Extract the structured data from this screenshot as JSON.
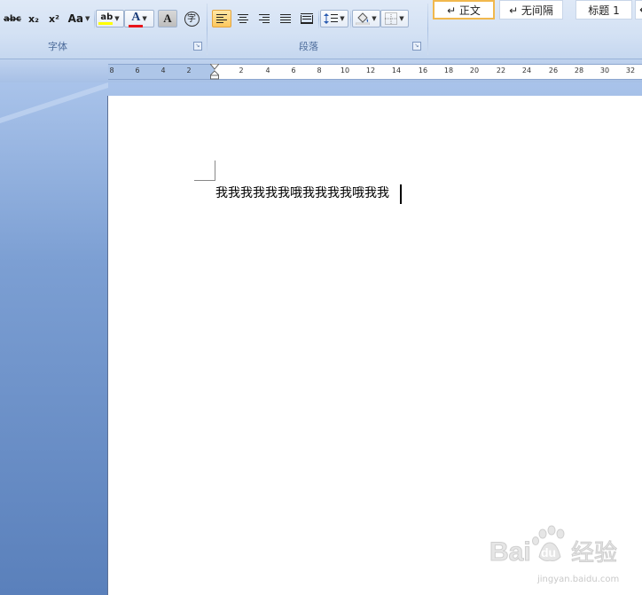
{
  "ribbon": {
    "font_group": {
      "label": "字体",
      "buttons": [
        {
          "name": "strikethrough-button",
          "label": "abc"
        },
        {
          "name": "subscript-button",
          "label": "x₂"
        },
        {
          "name": "superscript-button",
          "label": "x²"
        },
        {
          "name": "change-case-button",
          "label": "Aa"
        },
        {
          "name": "text-highlight-button",
          "label": "ab"
        },
        {
          "name": "font-color-button",
          "label": "A"
        },
        {
          "name": "character-shading-button",
          "label": "A"
        },
        {
          "name": "enclose-characters-button",
          "label": "字"
        }
      ]
    },
    "paragraph_group": {
      "label": "段落"
    },
    "styles": [
      {
        "label": "↵ 正文",
        "selected": true
      },
      {
        "label": "↵ 无间隔",
        "selected": false
      },
      {
        "label": "标题 1",
        "selected": false
      },
      {
        "label": "↵",
        "selected": false
      }
    ]
  },
  "ruler": {
    "left_ticks": [
      "8",
      "6",
      "4",
      "2"
    ],
    "right_ticks": [
      "2",
      "4",
      "6",
      "8",
      "10",
      "12",
      "14",
      "16",
      "18",
      "20",
      "22",
      "24",
      "26",
      "28",
      "30",
      "32"
    ]
  },
  "document": {
    "text": "我我我我我我哦我我我我哦我我"
  },
  "watermark": {
    "brand": "Bai",
    "brand2": "du",
    "brand3": "经验",
    "domain": "jingyan.baidu.com"
  },
  "colors": {
    "highlight_yellow": "#ffff00",
    "font_red": "#e8141a",
    "selected_style_border": "#f1b84d",
    "workspace_blue": "#6a8fc6"
  }
}
